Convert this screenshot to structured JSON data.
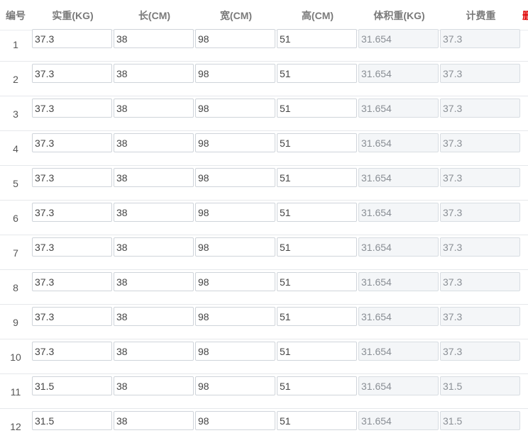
{
  "table": {
    "headers": {
      "no": "编号",
      "weight": "实重(KG)",
      "length": "长(CM)",
      "width": "宽(CM)",
      "height": "高(CM)",
      "volume_weight": "体积重(KG)",
      "charge_weight": "计费重",
      "extra": "删"
    },
    "rows": [
      {
        "no": "1",
        "weight": "37.3",
        "length": "38",
        "width": "98",
        "height": "51",
        "volume_weight": "31.654",
        "charge_weight": "37.3"
      },
      {
        "no": "2",
        "weight": "37.3",
        "length": "38",
        "width": "98",
        "height": "51",
        "volume_weight": "31.654",
        "charge_weight": "37.3"
      },
      {
        "no": "3",
        "weight": "37.3",
        "length": "38",
        "width": "98",
        "height": "51",
        "volume_weight": "31.654",
        "charge_weight": "37.3"
      },
      {
        "no": "4",
        "weight": "37.3",
        "length": "38",
        "width": "98",
        "height": "51",
        "volume_weight": "31.654",
        "charge_weight": "37.3"
      },
      {
        "no": "5",
        "weight": "37.3",
        "length": "38",
        "width": "98",
        "height": "51",
        "volume_weight": "31.654",
        "charge_weight": "37.3"
      },
      {
        "no": "6",
        "weight": "37.3",
        "length": "38",
        "width": "98",
        "height": "51",
        "volume_weight": "31.654",
        "charge_weight": "37.3"
      },
      {
        "no": "7",
        "weight": "37.3",
        "length": "38",
        "width": "98",
        "height": "51",
        "volume_weight": "31.654",
        "charge_weight": "37.3"
      },
      {
        "no": "8",
        "weight": "37.3",
        "length": "38",
        "width": "98",
        "height": "51",
        "volume_weight": "31.654",
        "charge_weight": "37.3"
      },
      {
        "no": "9",
        "weight": "37.3",
        "length": "38",
        "width": "98",
        "height": "51",
        "volume_weight": "31.654",
        "charge_weight": "37.3"
      },
      {
        "no": "10",
        "weight": "37.3",
        "length": "38",
        "width": "98",
        "height": "51",
        "volume_weight": "31.654",
        "charge_weight": "37.3"
      },
      {
        "no": "11",
        "weight": "31.5",
        "length": "38",
        "width": "98",
        "height": "51",
        "volume_weight": "31.654",
        "charge_weight": "31.5"
      },
      {
        "no": "12",
        "weight": "31.5",
        "length": "38",
        "width": "98",
        "height": "51",
        "volume_weight": "31.654",
        "charge_weight": "31.5"
      }
    ]
  },
  "colors": {
    "header_text": "#7a7a7a",
    "extra_header": "#e00000",
    "readonly_bg": "#f4f6f8",
    "border": "#cfd4da"
  }
}
